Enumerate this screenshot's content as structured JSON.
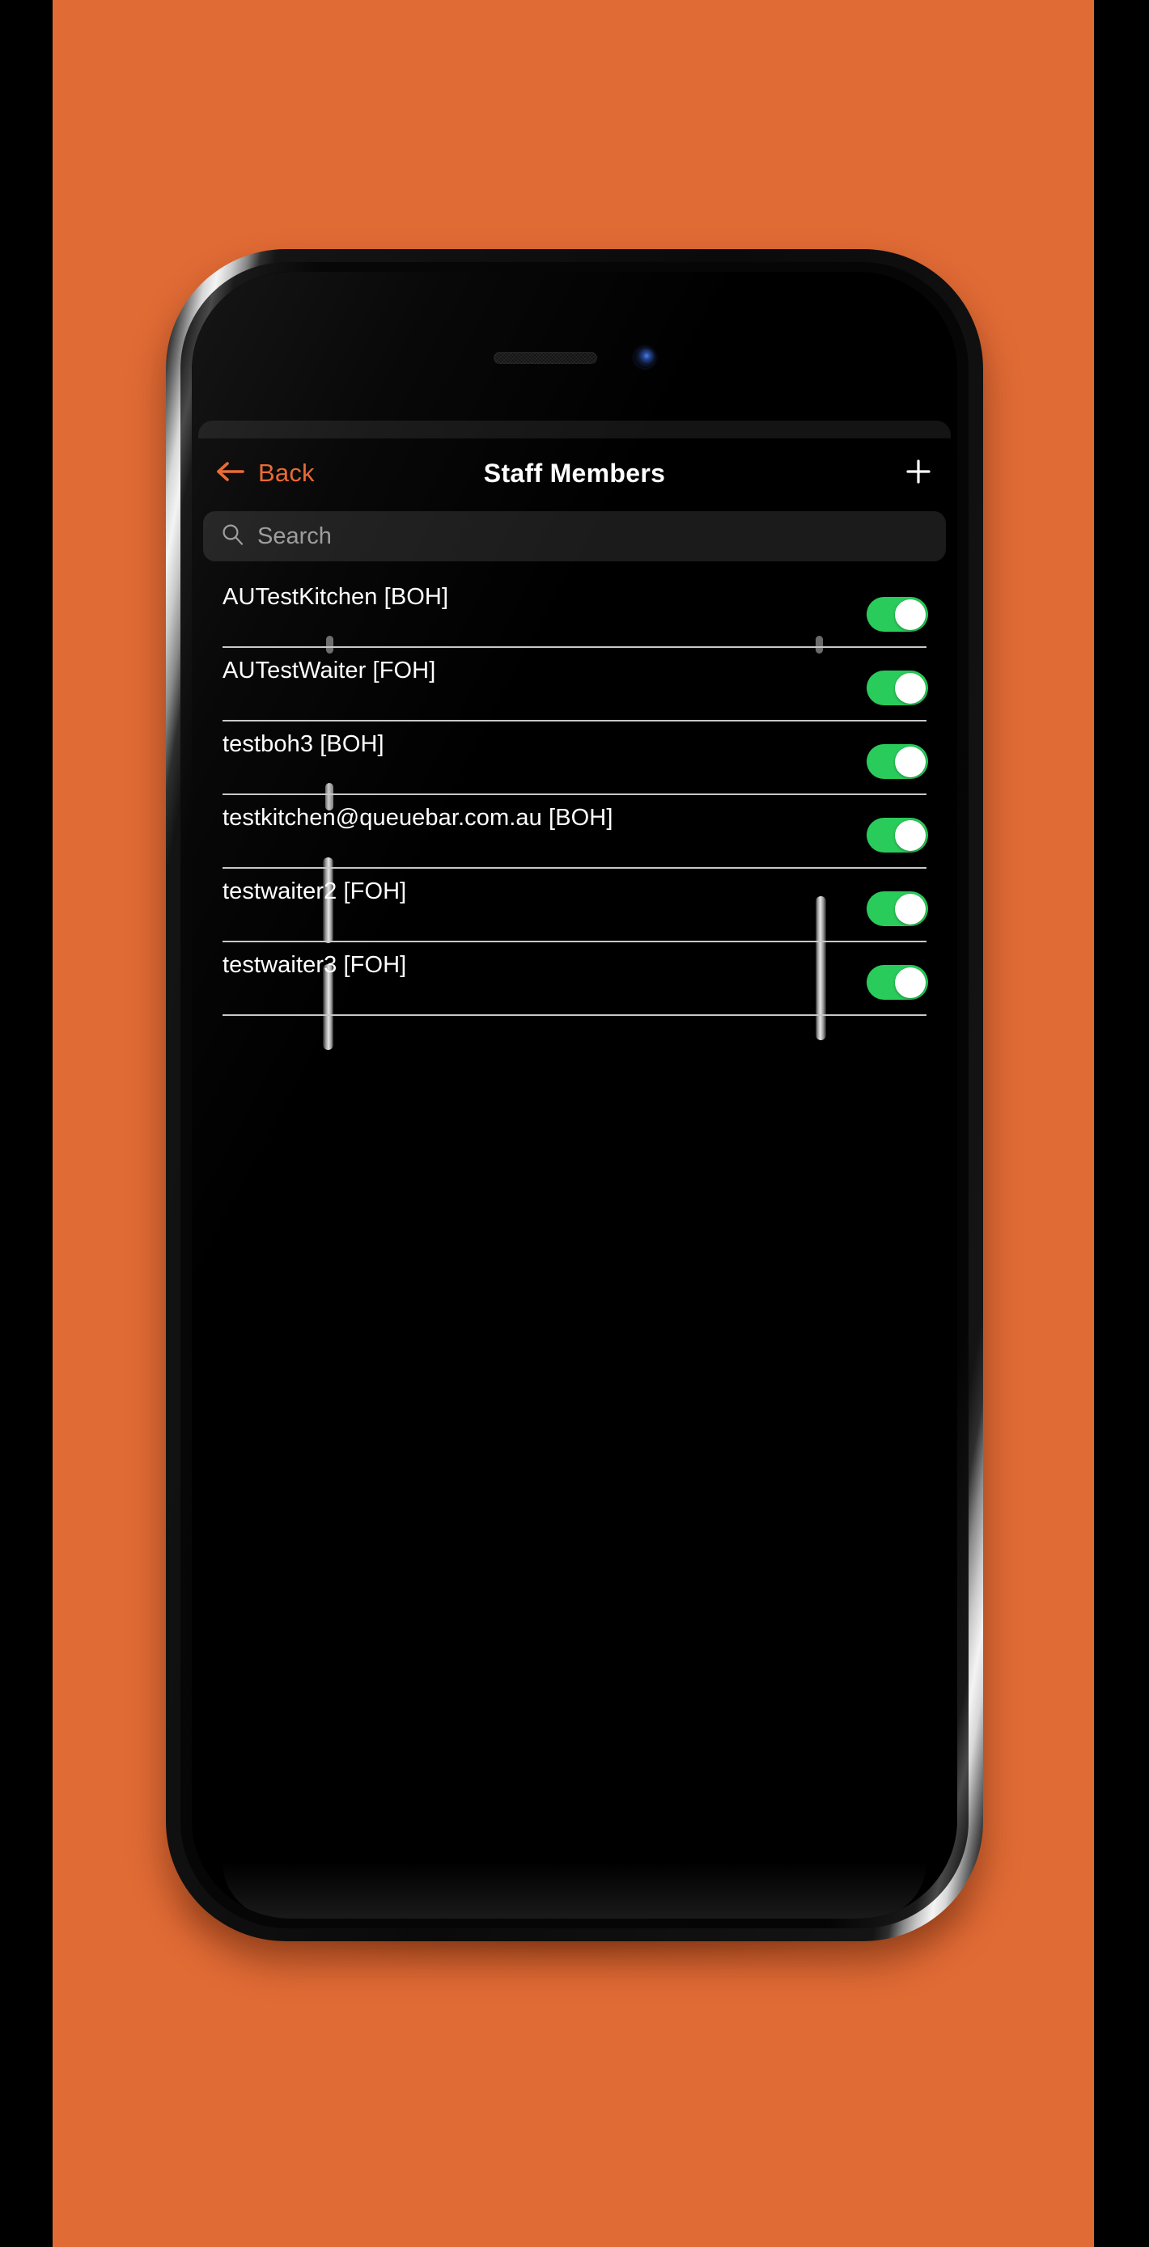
{
  "theme": {
    "backdrop_color": "#E16B35",
    "accent_color": "#E8642B",
    "toggle_on_color": "#29cc5a",
    "screen_bg": "#000000",
    "search_bg": "#1b1b1b",
    "divider_color": "#c8c8c8",
    "text_color": "#ffffff",
    "placeholder_color": "#9a9a9a"
  },
  "navbar": {
    "back_label": "Back",
    "back_icon": "arrow-left-icon",
    "title": "Staff Members",
    "add_icon": "plus-icon"
  },
  "search": {
    "icon": "search-icon",
    "placeholder": "Search",
    "value": ""
  },
  "device": {
    "earpiece": "earpiece-speaker",
    "camera": "front-camera",
    "buttons": [
      "mute-switch",
      "volume-up",
      "volume-down",
      "power"
    ]
  },
  "staff": {
    "rows": [
      {
        "name": "AUTestKitchen [BOH]",
        "enabled": true
      },
      {
        "name": "AUTestWaiter [FOH]",
        "enabled": true
      },
      {
        "name": "testboh3 [BOH]",
        "enabled": true
      },
      {
        "name": "testkitchen@queuebar.com.au [BOH]",
        "enabled": true
      },
      {
        "name": "testwaiter2 [FOH]",
        "enabled": true
      },
      {
        "name": "testwaiter3 [FOH]",
        "enabled": true
      }
    ]
  }
}
